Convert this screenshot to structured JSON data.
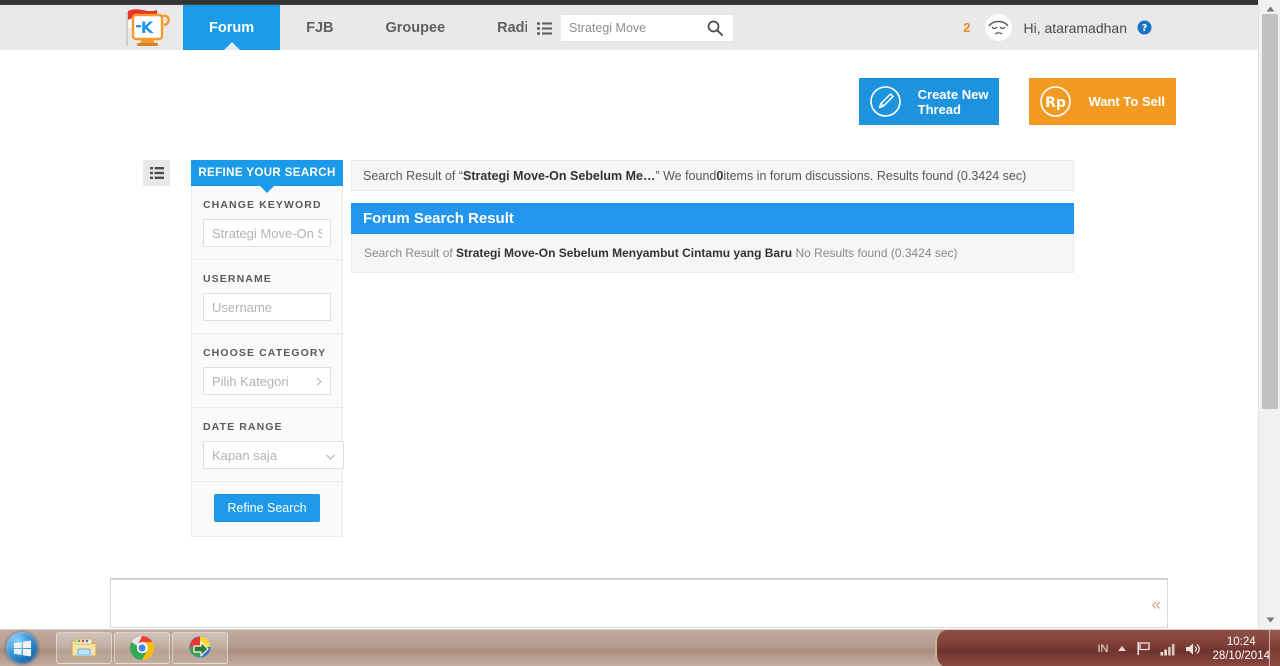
{
  "browser": {
    "chrome_strip": ""
  },
  "header": {
    "logo_name": "kaskus-logo",
    "nav": [
      {
        "label": "Forum",
        "active": true
      },
      {
        "label": "FJB",
        "active": false
      },
      {
        "label": "Groupee",
        "active": false
      },
      {
        "label": "Radio",
        "active": false
      }
    ],
    "search": {
      "category_icon": "list-icon",
      "value": "Strategi Move",
      "placeholder": "Strategi Move",
      "search_icon": "search-icon"
    },
    "notification_count": "2",
    "avatar_name": "user-avatar",
    "greeting": "Hi, ataramadhan",
    "help_icon": "help-icon",
    "colors": {
      "nav_active": "#1a9ae8",
      "bar": "#e9e9e9",
      "notif": "#f08a24"
    }
  },
  "actions": [
    {
      "icon": "pencil-icon",
      "label": "Create New Thread",
      "label_line1": "Create New",
      "label_line2": "Thread",
      "color": "#1d93dd"
    },
    {
      "icon": "rupiah-icon",
      "label": "Want To Sell",
      "label_line1": "Want To Sell",
      "label_line2": "",
      "color": "#f39a22"
    }
  ],
  "content": {
    "list_toggle_icon": "list-view-icon",
    "refine": {
      "title": "REFINE YOUR SEARCH",
      "fields": [
        {
          "label": "CHANGE KEYWORD",
          "type": "input",
          "value": "",
          "placeholder": "Strategi Move-On Se"
        },
        {
          "label": "USERNAME",
          "type": "input",
          "value": "",
          "placeholder": "Username"
        },
        {
          "label": "CHOOSE CATEGORY",
          "type": "select-right",
          "value": "Pilih Kategori"
        },
        {
          "label": "DATE RANGE",
          "type": "select-down",
          "value": "Kapan saja"
        }
      ],
      "submit_label": "Refine Search"
    },
    "summary": {
      "prefix": "Search Result of “",
      "query_truncated": "Strategi Move-On Sebelum Me…",
      "middle": "” We found ",
      "count": "0",
      "suffix": " items in forum discussions. Results found (0.3424 sec)"
    },
    "panel": {
      "title": "Forum Search Result",
      "body_prefix": "Search Result of ",
      "body_query": "Strategi Move-On Sebelum Menyambut Cintamu yang Baru",
      "body_suffix": " No Results found (0.3424 sec)"
    },
    "bottom_panel": {
      "collapse_icon": "double-chevron-left-icon"
    }
  },
  "scrollbar": {
    "up_icon": "scroll-up-arrow",
    "down_icon": "scroll-down-arrow",
    "thumb_name": "scrollbar-thumb"
  },
  "taskbar": {
    "start_icon": "windows-start-orb",
    "items": [
      {
        "icon": "file-explorer-icon",
        "name": "taskbar-item-explorer"
      },
      {
        "icon": "google-chrome-icon",
        "name": "taskbar-item-chrome"
      },
      {
        "icon": "internet-download-manager-icon",
        "name": "taskbar-item-idm"
      }
    ],
    "tray": {
      "language": "IN",
      "show_hidden_icon": "show-hidden-icons-arrow",
      "action_center_icon": "flag-icon",
      "network_icon": "network-signal-icon",
      "volume_icon": "volume-icon"
    },
    "clock": {
      "time": "10:24",
      "date": "28/10/2014"
    },
    "show_desktop_name": "show-desktop-button"
  }
}
